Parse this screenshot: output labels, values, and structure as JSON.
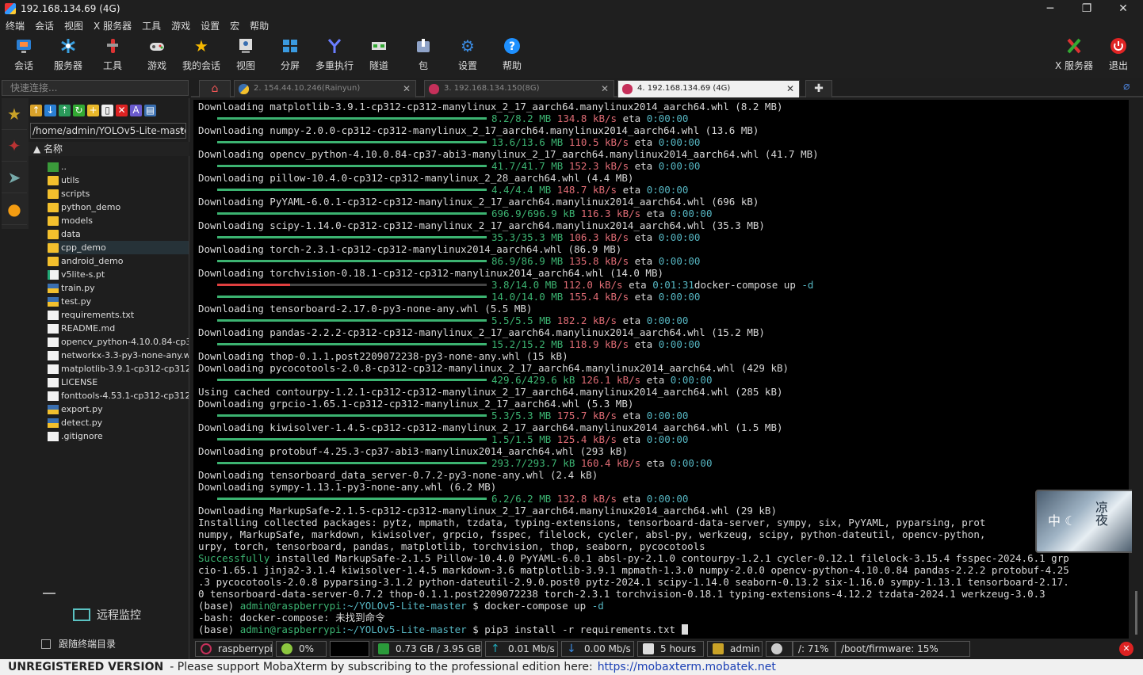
{
  "window": {
    "title": "192.168.134.69 (4G)",
    "min": "─",
    "max": "❐",
    "close": "✕"
  },
  "menu": [
    "终端",
    "会话",
    "视图",
    "X 服务器",
    "工具",
    "游戏",
    "设置",
    "宏",
    "帮助"
  ],
  "toolbar": {
    "left": [
      {
        "label": "会话",
        "icon": "session-icon"
      },
      {
        "label": "服务器",
        "icon": "servers-icon"
      },
      {
        "label": "工具",
        "icon": "tools-icon"
      },
      {
        "label": "游戏",
        "icon": "games-icon"
      },
      {
        "label": "我的会话",
        "icon": "star-icon"
      },
      {
        "label": "视图",
        "icon": "view-icon"
      },
      {
        "label": "分屏",
        "icon": "split-icon"
      },
      {
        "label": "多重执行",
        "icon": "multiexec-icon"
      },
      {
        "label": "隧道",
        "icon": "tunnel-icon"
      },
      {
        "label": "包",
        "icon": "package-icon"
      },
      {
        "label": "设置",
        "icon": "settings-icon"
      },
      {
        "label": "帮助",
        "icon": "help-icon"
      }
    ],
    "right": [
      {
        "label": "X 服务器",
        "icon": "xserver-icon"
      },
      {
        "label": "退出",
        "icon": "power-icon"
      }
    ]
  },
  "quick_connect": {
    "placeholder": "快速连接..."
  },
  "sftp": {
    "path": "/home/admin/YOLOv5-Lite-master",
    "column_header": "名称",
    "files": [
      {
        "name": "..",
        "type": "up"
      },
      {
        "name": "utils",
        "type": "dir"
      },
      {
        "name": "scripts",
        "type": "dir"
      },
      {
        "name": "python_demo",
        "type": "dir"
      },
      {
        "name": "models",
        "type": "dir"
      },
      {
        "name": "data",
        "type": "dir"
      },
      {
        "name": "cpp_demo",
        "type": "dir"
      },
      {
        "name": "android_demo",
        "type": "dir"
      },
      {
        "name": "v5lite-s.pt",
        "type": "pt"
      },
      {
        "name": "train.py",
        "type": "py"
      },
      {
        "name": "test.py",
        "type": "py"
      },
      {
        "name": "requirements.txt",
        "type": "doc"
      },
      {
        "name": "README.md",
        "type": "doc"
      },
      {
        "name": "opencv_python-4.10.0.84-cp37-",
        "type": "doc"
      },
      {
        "name": "networkx-3.3-py3-none-any.whl",
        "type": "doc"
      },
      {
        "name": "matplotlib-3.9.1-cp312-cp312-ma",
        "type": "doc"
      },
      {
        "name": "LICENSE",
        "type": "doc"
      },
      {
        "name": "fonttools-4.53.1-cp312-cp312-ma",
        "type": "doc"
      },
      {
        "name": "export.py",
        "type": "py"
      },
      {
        "name": "detect.py",
        "type": "py"
      },
      {
        "name": ".gitignore",
        "type": "doc"
      }
    ],
    "remote_monitor": "远程监控",
    "follow_terminal": "跟随终端目录"
  },
  "tabs": [
    {
      "label": "2. 154.44.10.246(Rainyun)",
      "close": "✕"
    },
    {
      "label": "3. 192.168.134.150(8G)",
      "close": "✕"
    },
    {
      "label": "4. 192.168.134.69 (4G)",
      "close": "✕"
    }
  ],
  "terminal": {
    "lines": [
      {
        "t": "Downloading matplotlib-3.9.1-cp312-cp312-manylinux_2_17_aarch64.manylinux2014_aarch64.whl (8.2 MB)"
      },
      {
        "p": "8.2/8.2 MB",
        "s": "134.8 kB/s",
        "e": "0:00:00"
      },
      {
        "t": "Downloading numpy-2.0.0-cp312-cp312-manylinux_2_17_aarch64.manylinux2014_aarch64.whl (13.6 MB)"
      },
      {
        "p": "13.6/13.6 MB",
        "s": "110.5 kB/s",
        "e": "0:00:00"
      },
      {
        "t": "Downloading opencv_python-4.10.0.84-cp37-abi3-manylinux_2_17_aarch64.manylinux2014_aarch64.whl (41.7 MB)"
      },
      {
        "p": "41.7/41.7 MB",
        "s": "152.3 kB/s",
        "e": "0:00:00"
      },
      {
        "t": "Downloading pillow-10.4.0-cp312-cp312-manylinux_2_28_aarch64.whl (4.4 MB)"
      },
      {
        "p": "4.4/4.4 MB",
        "s": "148.7 kB/s",
        "e": "0:00:00"
      },
      {
        "t": "Downloading PyYAML-6.0.1-cp312-cp312-manylinux_2_17_aarch64.manylinux2014_aarch64.whl (696 kB)"
      },
      {
        "p": "696.9/696.9 kB",
        "s": "116.3 kB/s",
        "e": "0:00:00"
      },
      {
        "t": "Downloading scipy-1.14.0-cp312-cp312-manylinux_2_17_aarch64.manylinux2014_aarch64.whl (35.3 MB)"
      },
      {
        "p": "35.3/35.3 MB",
        "s": "106.3 kB/s",
        "e": "0:00:00"
      },
      {
        "t": "Downloading torch-2.3.1-cp312-cp312-manylinux2014_aarch64.whl (86.9 MB)"
      },
      {
        "p": "86.9/86.9 MB",
        "s": "135.8 kB/s",
        "e": "0:00:00"
      },
      {
        "t": "Downloading torchvision-0.18.1-cp312-cp312-manylinux2014_aarch64.whl (14.0 MB)"
      },
      {
        "p": "3.8/14.0 MB",
        "s": "112.0 kB/s",
        "e": "0:01:31",
        "partial": true,
        "after": "docker-compose up ",
        "flag": "-d"
      },
      {
        "p": "14.0/14.0 MB",
        "s": "155.4 kB/s",
        "e": "0:00:00"
      },
      {
        "t": "Downloading tensorboard-2.17.0-py3-none-any.whl (5.5 MB)"
      },
      {
        "p": "5.5/5.5 MB",
        "s": "182.2 kB/s",
        "e": "0:00:00"
      },
      {
        "t": "Downloading pandas-2.2.2-cp312-cp312-manylinux_2_17_aarch64.manylinux2014_aarch64.whl (15.2 MB)"
      },
      {
        "p": "15.2/15.2 MB",
        "s": "118.9 kB/s",
        "e": "0:00:00"
      },
      {
        "t": "Downloading thop-0.1.1.post2209072238-py3-none-any.whl (15 kB)"
      },
      {
        "t": "Downloading pycocotools-2.0.8-cp312-cp312-manylinux_2_17_aarch64.manylinux2014_aarch64.whl (429 kB)"
      },
      {
        "p": "429.6/429.6 kB",
        "s": "126.1 kB/s",
        "e": "0:00:00"
      },
      {
        "t": "Using cached contourpy-1.2.1-cp312-cp312-manylinux_2_17_aarch64.manylinux2014_aarch64.whl (285 kB)"
      },
      {
        "t": "Downloading grpcio-1.65.1-cp312-cp312-manylinux_2_17_aarch64.whl (5.3 MB)"
      },
      {
        "p": "5.3/5.3 MB",
        "s": "175.7 kB/s",
        "e": "0:00:00"
      },
      {
        "t": "Downloading kiwisolver-1.4.5-cp312-cp312-manylinux_2_17_aarch64.manylinux2014_aarch64.whl (1.5 MB)"
      },
      {
        "p": "1.5/1.5 MB",
        "s": "125.4 kB/s",
        "e": "0:00:00"
      },
      {
        "t": "Downloading protobuf-4.25.3-cp37-abi3-manylinux2014_aarch64.whl (293 kB)"
      },
      {
        "p": "293.7/293.7 kB",
        "s": "160.4 kB/s",
        "e": "0:00:00"
      },
      {
        "t": "Downloading tensorboard_data_server-0.7.2-py3-none-any.whl (2.4 kB)"
      },
      {
        "t": "Downloading sympy-1.13.1-py3-none-any.whl (6.2 MB)"
      },
      {
        "p": "6.2/6.2 MB",
        "s": "132.8 kB/s",
        "e": "0:00:00"
      },
      {
        "t": "Downloading MarkupSafe-2.1.5-cp312-cp312-manylinux_2_17_aarch64.manylinux2014_aarch64.whl (29 kB)"
      },
      {
        "t": "Installing collected packages: pytz, mpmath, tzdata, typing-extensions, tensorboard-data-server, sympy, six, PyYAML, pyparsing, prot"
      },
      {
        "t": "numpy, MarkupSafe, markdown, kiwisolver, grpcio, fsspec, filelock, cycler, absl-py, werkzeug, scipy, python-dateutil, opencv-python,"
      },
      {
        "t": "urpy, torch, tensorboard, pandas, matplotlib, torchvision, thop, seaborn, pycocotools"
      },
      {
        "ok": "Successfully",
        "t": " installed MarkupSafe-2.1.5 Pillow-10.4.0 PyYAML-6.0.1 absl-py-2.1.0 contourpy-1.2.1 cycler-0.12.1 filelock-3.15.4 fsspec-2024.6.1 grp"
      },
      {
        "t": "cio-1.65.1 jinja2-3.1.4 kiwisolver-1.4.5 markdown-3.6 matplotlib-3.9.1 mpmath-1.3.0 numpy-2.0.0 opencv-python-4.10.0.84 pandas-2.2.2 protobuf-4.25"
      },
      {
        "t": ".3 pycocotools-2.0.8 pyparsing-3.1.2 python-dateutil-2.9.0.post0 pytz-2024.1 scipy-1.14.0 seaborn-0.13.2 six-1.16.0 sympy-1.13.1 tensorboard-2.17."
      },
      {
        "t": "0 tensorboard-data-server-0.7.2 thop-0.1.1.post2209072238 torch-2.3.1 torchvision-0.18.1 typing-extensions-4.12.2 tzdata-2024.1 werkzeug-3.0.3"
      },
      {
        "pre": "(base) ",
        "user": "admin@raspberrypi",
        "path": ":~/YOLOv5-Lite-master",
        "cmd": " $ docker-compose up ",
        "flag": "-d"
      },
      {
        "t": "-bash: docker-compose: 未找到命令"
      },
      {
        "pre": "(base) ",
        "user": "admin@raspberrypi",
        "path": ":~/YOLOv5-Lite-master",
        "cmd": " $ pip3 install -r requirements.txt ",
        "cursor": true
      }
    ]
  },
  "overlay": {
    "left_text": "中 ☾",
    "right_text": "凉夜"
  },
  "status": {
    "host": "raspberrypi",
    "cpu": "0%",
    "mem": "0.73 GB / 3.95 GB",
    "up": "0.01 Mb/s",
    "down": "0.00 Mb/s",
    "uptime": "5 hours",
    "user": "admin",
    "root": "/: 71%",
    "boot": "/boot/firmware: 15%",
    "cpu_level": 0
  },
  "footer": {
    "title": "UNREGISTERED VERSION",
    "text": "-  Please support MobaXterm by subscribing to the professional edition here:",
    "link": "https://mobaxterm.mobatek.net"
  },
  "colors": {
    "green": "#3cb371",
    "red": "#e06c75",
    "cyan": "#56b6c2"
  }
}
